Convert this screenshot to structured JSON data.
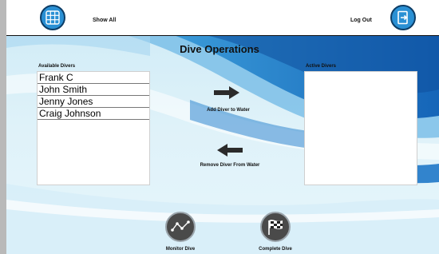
{
  "header": {
    "show_all_label": "Show All",
    "log_out_label": "Log Out",
    "menu_icon": "grid-icon",
    "logout_icon": "exit-door-icon"
  },
  "page": {
    "title": "Dive Operations"
  },
  "available": {
    "label": "Available Divers",
    "items": [
      "Frank C",
      "John Smith",
      "Jenny Jones",
      "Craig Johnson"
    ]
  },
  "active": {
    "label": "Active Divers",
    "items": []
  },
  "actions": {
    "add_label": "Add Diver to Water",
    "remove_label": "Remove Diver From Water",
    "add_icon": "arrow-right-icon",
    "remove_icon": "arrow-left-icon"
  },
  "footer": {
    "monitor_label": "Monitor Dive",
    "complete_label": "Complete Dive",
    "monitor_icon": "line-graph-icon",
    "complete_icon": "checkered-flag-icon"
  },
  "colors": {
    "accent_blue": "#2a90d4",
    "wave_blue": "#1f78c8"
  }
}
